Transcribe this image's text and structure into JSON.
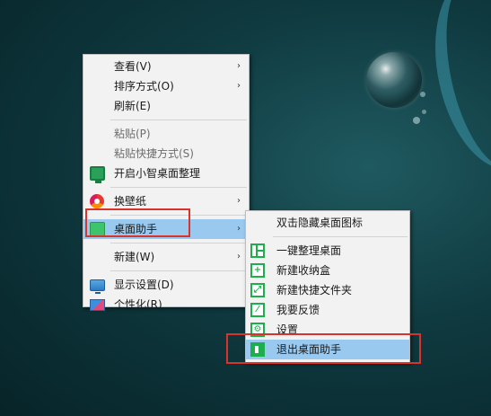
{
  "context_menu": {
    "items": [
      {
        "label": "查看(V)",
        "submenu": true
      },
      {
        "label": "排序方式(O)",
        "submenu": true
      },
      {
        "label": "刷新(E)"
      },
      {
        "label": "粘贴(P)",
        "disabled": true
      },
      {
        "label": "粘贴快捷方式(S)",
        "disabled": true
      },
      {
        "label": "开启小智桌面整理",
        "icon": "monitor-green-icon"
      },
      {
        "label": "换壁纸",
        "icon": "wallpaper-icon",
        "submenu": true
      },
      {
        "label": "桌面助手",
        "icon": "desktop-assistant-icon",
        "submenu": true,
        "highlighted": true
      },
      {
        "label": "新建(W)",
        "submenu": true
      },
      {
        "label": "显示设置(D)",
        "icon": "display-icon"
      },
      {
        "label": "个性化(R)",
        "icon": "personalize-icon"
      }
    ]
  },
  "submenu": {
    "items": [
      {
        "label": "双击隐藏桌面图标"
      },
      {
        "label": "一键整理桌面",
        "icon": "organize-icon"
      },
      {
        "label": "新建收纳盒",
        "icon": "plus-box-icon"
      },
      {
        "label": "新建快捷文件夹",
        "icon": "expand-arrow-icon"
      },
      {
        "label": "我要反馈",
        "icon": "pencil-icon"
      },
      {
        "label": "设置",
        "icon": "gear-icon"
      },
      {
        "label": "退出桌面助手",
        "icon": "exit-icon",
        "highlighted": true
      }
    ]
  },
  "glyphs": {
    "submenu_arrow": "›",
    "plus": "+",
    "expand": "⤢",
    "pencil": "⁄",
    "gear": "⚙"
  },
  "colors": {
    "highlight": "#99c9ef",
    "annotation_red": "#d9342b",
    "icon_green": "#1fae4e"
  }
}
